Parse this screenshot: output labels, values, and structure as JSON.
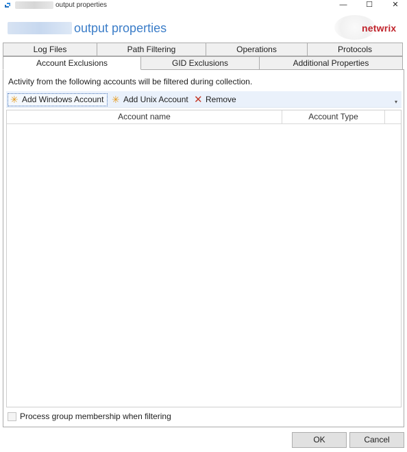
{
  "window": {
    "title": "output properties",
    "minimize_glyph": "—",
    "maximize_glyph": "☐",
    "close_glyph": "✕"
  },
  "header": {
    "title": "output properties",
    "brand": "netwrix"
  },
  "tabs": {
    "row1": [
      {
        "label": "Log Files"
      },
      {
        "label": "Path Filtering"
      },
      {
        "label": "Operations"
      },
      {
        "label": "Protocols"
      }
    ],
    "row2": [
      {
        "label": "Account Exclusions",
        "selected": true
      },
      {
        "label": "GID Exclusions"
      },
      {
        "label": "Additional Properties"
      }
    ]
  },
  "content": {
    "description": "Activity from the following accounts will be filtered during collection."
  },
  "toolbar": {
    "add_windows": "Add Windows Account",
    "add_unix": "Add Unix Account",
    "remove": "Remove",
    "star_glyph": "✳",
    "remove_glyph": "✕",
    "overflow_glyph": "▾"
  },
  "grid": {
    "columns": [
      "Account name",
      "Account Type"
    ],
    "rows": []
  },
  "options": {
    "process_group_membership": "Process group membership when filtering",
    "process_group_membership_checked": false
  },
  "footer": {
    "ok": "OK",
    "cancel": "Cancel"
  },
  "colors": {
    "accent": "#3b7dc8",
    "brand": "#c0232b",
    "toolbar_bg": "#eaf1fb"
  }
}
